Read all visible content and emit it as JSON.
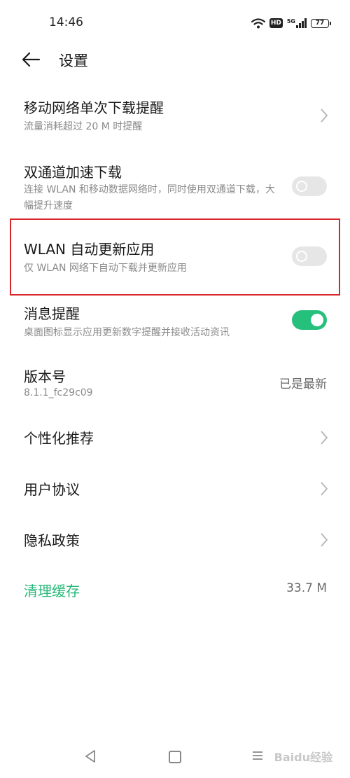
{
  "status_bar": {
    "time": "14:46",
    "hd_label": "HD",
    "network_label": "5G",
    "battery": "77",
    "icons": [
      "wifi-icon",
      "hd-icon",
      "signal-icon",
      "battery-icon"
    ]
  },
  "header": {
    "title": "设置",
    "back_icon": "arrow-left-icon"
  },
  "settings": [
    {
      "title": "移动网络单次下载提醒",
      "subtitle": "流量消耗超过 20 M 时提醒",
      "control": "chevron"
    },
    {
      "title": "双通道加速下载",
      "subtitle": "连接 WLAN 和移动数据网络时，同时使用双通道下载，大幅提升速度",
      "control": "toggle",
      "toggle_on": false
    },
    {
      "title": "WLAN 自动更新应用",
      "subtitle": "仅 WLAN 网络下自动下载并更新应用",
      "control": "toggle",
      "toggle_on": false
    },
    {
      "title": "消息提醒",
      "subtitle": "桌面图标显示应用更新数字提醒并接收活动资讯",
      "control": "toggle",
      "toggle_on": true
    },
    {
      "title": "版本号",
      "subtitle": "8.1.1_fc29c09",
      "control": "value",
      "value": "已是最新"
    },
    {
      "title": "个性化推荐",
      "control": "chevron"
    },
    {
      "title": "用户协议",
      "control": "chevron"
    },
    {
      "title": "隐私政策",
      "control": "chevron"
    },
    {
      "title": "清理缓存",
      "control": "value",
      "value": "33.7 M"
    }
  ],
  "colors": {
    "accent_green": "#26b877",
    "highlight_red": "#d8262c",
    "toggle_off": "#e6e6e6"
  },
  "nav_bar": {
    "icons": [
      "nav-back-icon",
      "nav-home-icon",
      "nav-menu-icon"
    ]
  },
  "watermark": "Baidu经验"
}
